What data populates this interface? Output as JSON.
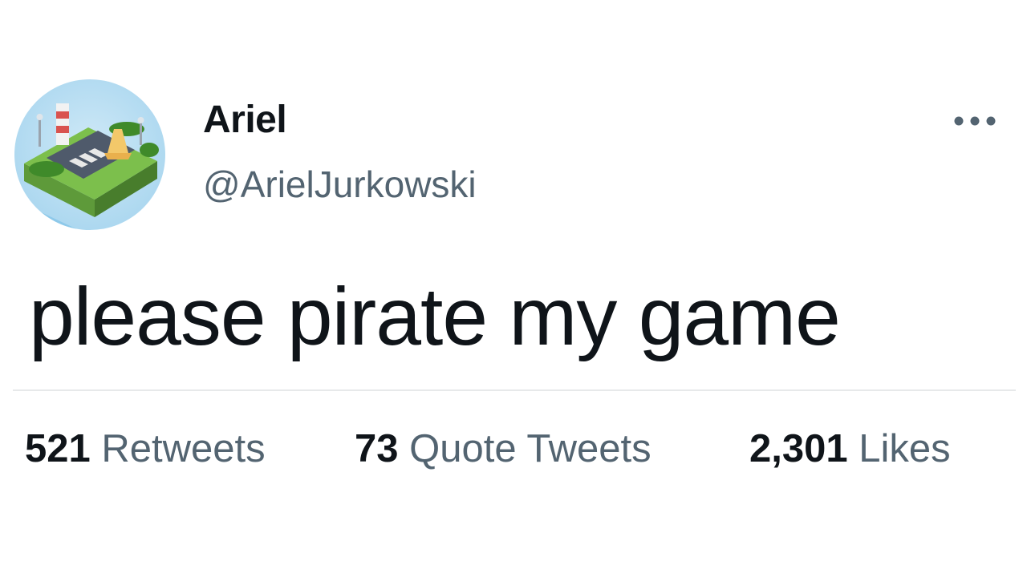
{
  "author": {
    "display_name": "Ariel",
    "handle": "@ArielJurkowski",
    "avatar": "isometric-game-scene-avatar"
  },
  "tweet": {
    "text": "please pirate my game"
  },
  "menu": {
    "icon": "more-horizontal-icon"
  },
  "stats": {
    "retweets": {
      "count": "521",
      "label": "Retweets"
    },
    "quote_tweets": {
      "count": "73",
      "label": "Quote Tweets"
    },
    "likes": {
      "count": "2,301",
      "label": "Likes"
    }
  },
  "colors": {
    "primary_text": "#0f1419",
    "secondary_text": "#536471",
    "divider": "#e7e9ea",
    "background": "#ffffff"
  }
}
